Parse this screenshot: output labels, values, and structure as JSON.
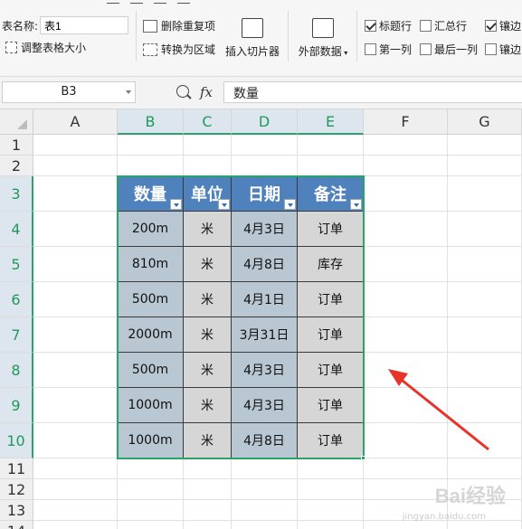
{
  "ribbon": {
    "table_name_label": "表名称:",
    "table_name_value": "表1",
    "resize_table": "调整表格大小",
    "remove_duplicates": "删除重复项",
    "convert_to_range": "转换为区域",
    "insert_slicer": "插入切片器",
    "external_data": "外部数据",
    "options": [
      {
        "label": "标题行",
        "checked": true
      },
      {
        "label": "汇总行",
        "checked": false
      },
      {
        "label": "镶边",
        "checked": true
      },
      {
        "label": "第一列",
        "checked": false
      },
      {
        "label": "最后一列",
        "checked": false
      },
      {
        "label": "镶边",
        "checked": false
      }
    ]
  },
  "formula_bar": {
    "cell_ref": "B3",
    "fx": "fx",
    "content": "数量"
  },
  "sheet": {
    "columns": [
      "A",
      "B",
      "C",
      "D",
      "E",
      "F",
      "G"
    ],
    "rows": [
      "1",
      "2",
      "3",
      "4",
      "5",
      "6",
      "7",
      "8",
      "9",
      "10",
      "11",
      "12",
      "13",
      "14"
    ]
  },
  "table": {
    "headers": [
      "数量",
      "单位",
      "日期",
      "备注"
    ],
    "rows": [
      [
        "200m",
        "米",
        "4月3日",
        "订单"
      ],
      [
        "810m",
        "米",
        "4月8日",
        "库存"
      ],
      [
        "500m",
        "米",
        "4月1日",
        "订单"
      ],
      [
        "2000m",
        "米",
        "3月31日",
        "订单"
      ],
      [
        "500m",
        "米",
        "4月3日",
        "订单"
      ],
      [
        "1000m",
        "米",
        "4月3日",
        "订单"
      ],
      [
        "1000m",
        "米",
        "4月8日",
        "订单"
      ]
    ]
  },
  "annotation": {
    "arrow_color": "#e8332a"
  },
  "watermark": {
    "text": "Bai经验",
    "sub": "jingyan.baidu.com"
  }
}
